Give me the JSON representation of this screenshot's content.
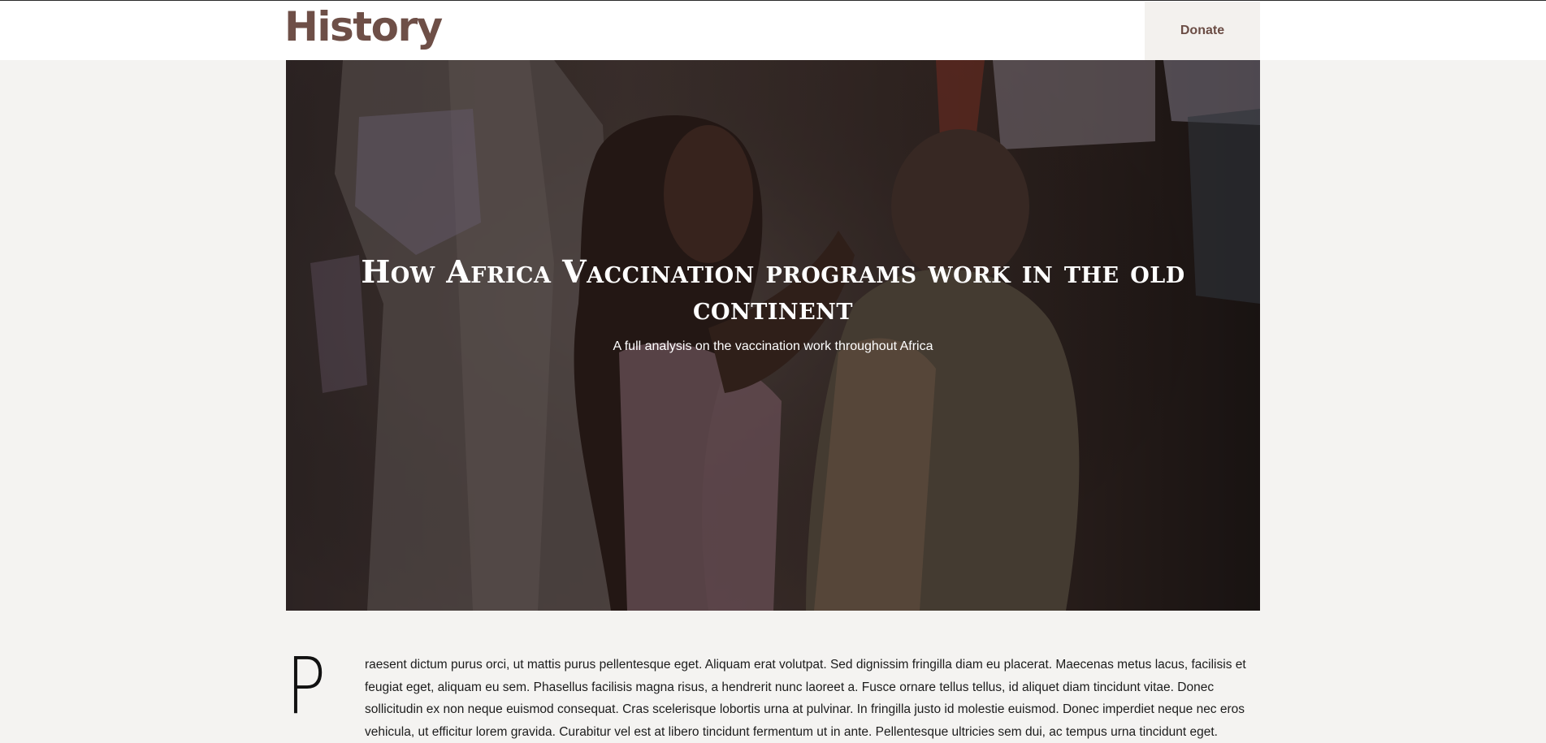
{
  "header": {
    "logo": "History",
    "donate_label": "Donate"
  },
  "hero": {
    "title": "How Africa Vaccination programs work in the old continent",
    "subtitle": "A full analysis on the vaccination work throughout Africa",
    "image": "photo of a woman holding a child"
  },
  "article": {
    "drop_cap": "P",
    "body": "raesent dictum purus orci, ut mattis purus pellentesque eget. Aliquam erat volutpat. Sed dignissim fringilla diam eu placerat. Maecenas metus lacus, facilisis et feugiat eget, aliquam eu sem. Phasellus facilisis magna risus, a hendrerit nunc laoreet a. Fusce ornare tellus tellus, id aliquet diam tincidunt vitae. Donec sollicitudin ex non neque euismod consequat. Cras scelerisque lobortis urna at pulvinar. In fringilla justo id molestie euismod. Donec imperdiet neque nec eros vehicula, ut efficitur lorem gravida. Curabitur vel est at libero tincidunt fermentum ut in ante. Pellentesque ultricies sem dui, ac tempus urna tincidunt eget."
  },
  "colors": {
    "brand": "#6e4f47",
    "page_background": "#f4f3f1",
    "header_background": "#ffffff",
    "donate_background": "#f3f1ee"
  }
}
